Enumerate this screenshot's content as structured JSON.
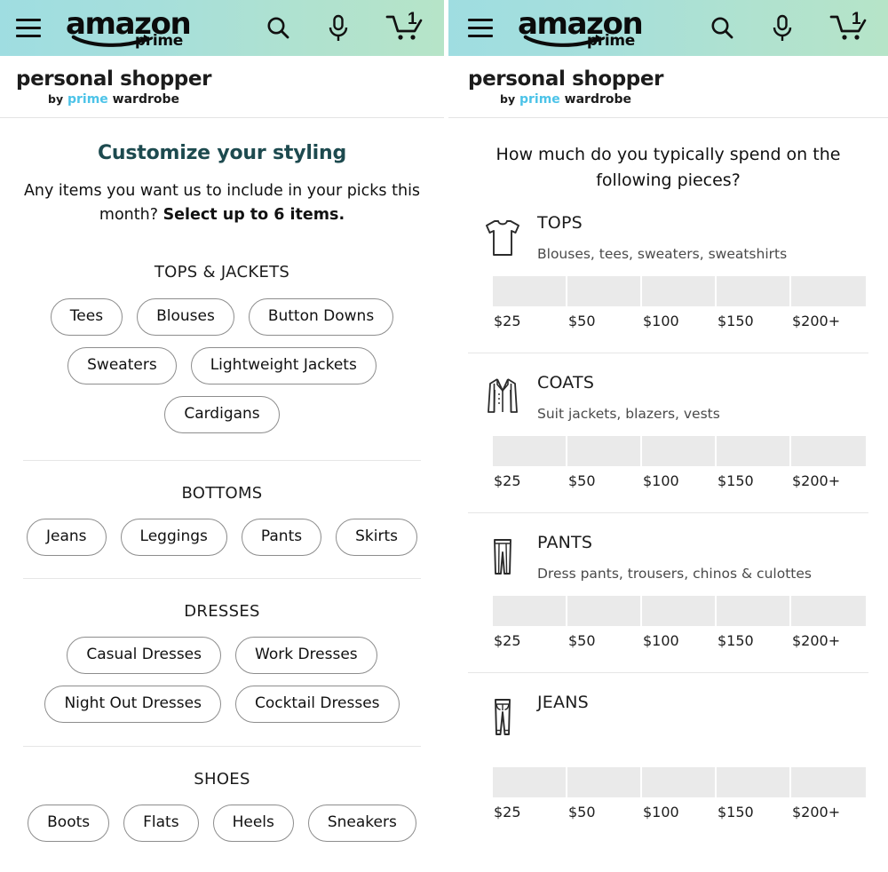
{
  "nav": {
    "menu_icon": "hamburger-menu-icon",
    "logo_text": "amazon",
    "logo_sub": "prime",
    "search_icon": "search-icon",
    "mic_icon": "microphone-icon",
    "cart_icon": "shopping-cart-icon",
    "cart_count": "1"
  },
  "brand": {
    "main": "personal shopper",
    "by": "by",
    "prime": "prime",
    "wardrobe": "wardrobe",
    "prime_color": "#4cc3e8"
  },
  "left": {
    "title": "Customize your styling",
    "subtitle_normal": "Any items you want us to include in your picks this month? ",
    "subtitle_bold": "Select up to 6 items.",
    "sections": [
      {
        "name": "TOPS & JACKETS",
        "chips": [
          "Tees",
          "Blouses",
          "Button Downs",
          "Sweaters",
          "Lightweight Jackets",
          "Cardigans"
        ]
      },
      {
        "name": "BOTTOMS",
        "chips": [
          "Jeans",
          "Leggings",
          "Pants",
          "Skirts"
        ]
      },
      {
        "name": "DRESSES",
        "chips": [
          "Casual Dresses",
          "Work Dresses",
          "Night Out Dresses",
          "Cocktail Dresses"
        ]
      },
      {
        "name": "SHOES",
        "chips": [
          "Boots",
          "Flats",
          "Heels",
          "Sneakers"
        ]
      }
    ]
  },
  "right": {
    "question": "How much do you typically spend on the following pieces?",
    "price_labels": [
      "$25",
      "$50",
      "$100",
      "$150",
      "$200+"
    ],
    "items": [
      {
        "icon": "tshirt-icon",
        "name": "TOPS",
        "desc": "Blouses, tees, sweaters, sweatshirts"
      },
      {
        "icon": "coat-icon",
        "name": "COATS",
        "desc": "Suit jackets, blazers, vests"
      },
      {
        "icon": "pants-icon",
        "name": "PANTS",
        "desc": "Dress pants, trousers, chinos & culottes"
      },
      {
        "icon": "jeans-icon",
        "name": "JEANS",
        "desc": ""
      }
    ]
  },
  "theme": {
    "header_gradient_start": "#9fdde1",
    "header_gradient_end": "#b6e4c8",
    "title_teal": "#1d4a4f",
    "bar_gray": "#eaeaea"
  }
}
